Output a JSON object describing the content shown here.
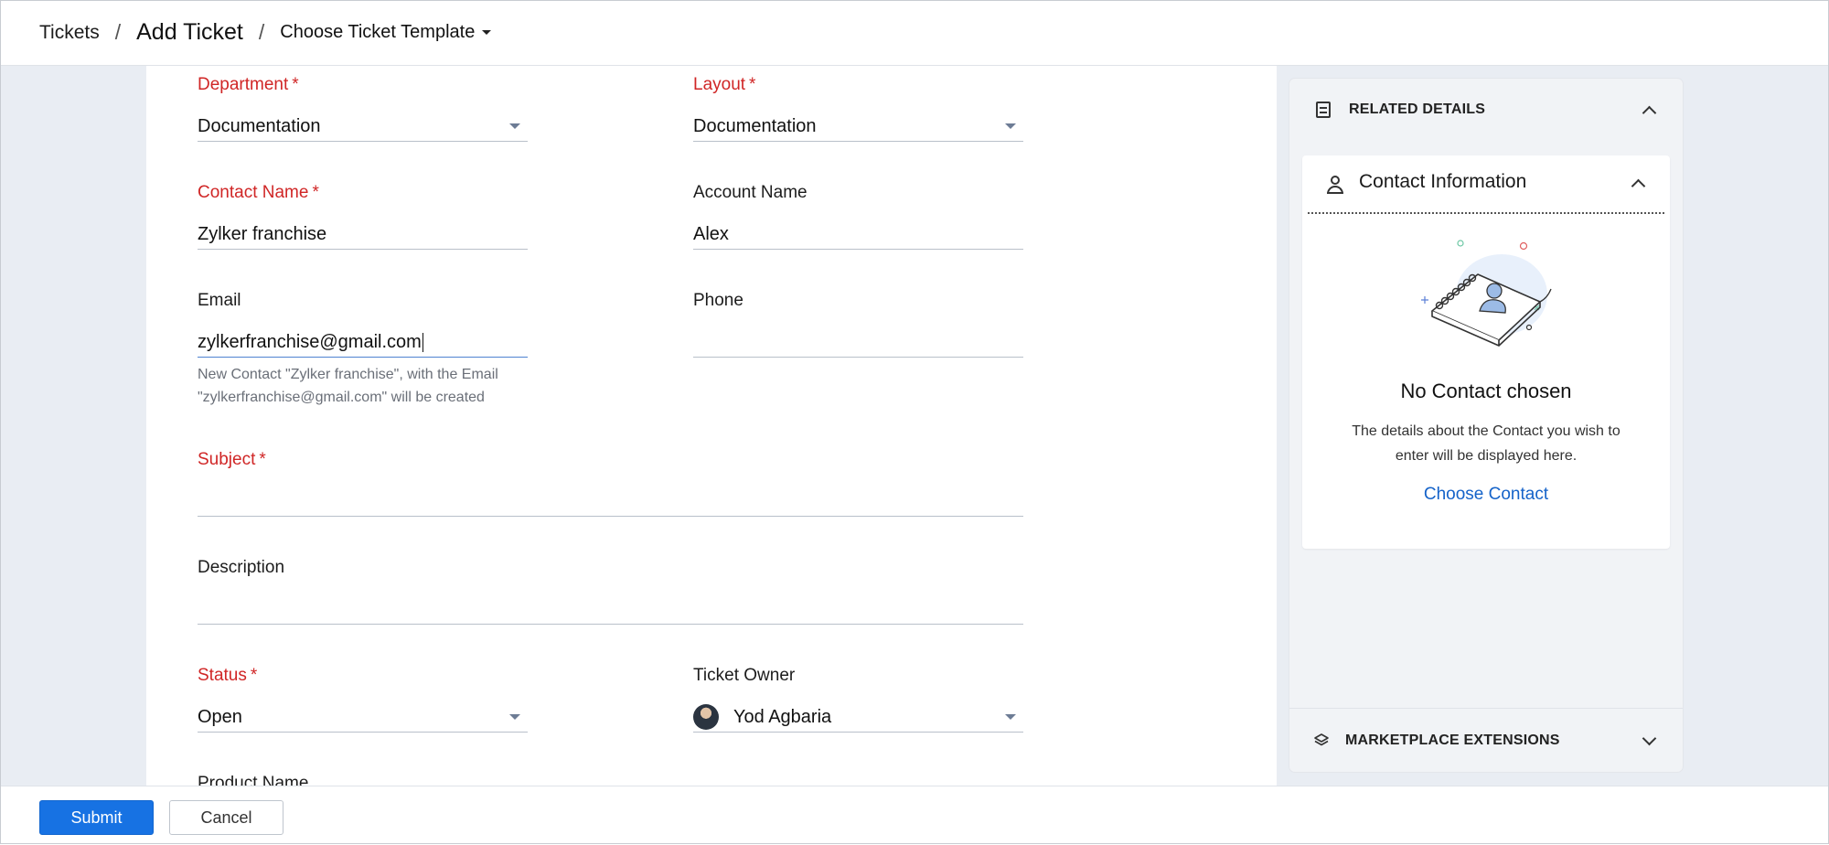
{
  "breadcrumb": {
    "tickets": "Tickets",
    "separator": "/",
    "add_ticket": "Add Ticket",
    "template": "Choose Ticket Template"
  },
  "form": {
    "department": {
      "label": "Department",
      "value": "Documentation"
    },
    "layout": {
      "label": "Layout",
      "value": "Documentation"
    },
    "contact_name": {
      "label": "Contact Name",
      "value": "Zylker franchise"
    },
    "account_name": {
      "label": "Account Name",
      "value": "Alex"
    },
    "email": {
      "label": "Email",
      "value": "zylkerfranchise@gmail.com",
      "hint": "New Contact \"Zylker franchise\", with the Email \"zylkerfranchise@gmail.com\" will be created"
    },
    "phone": {
      "label": "Phone",
      "value": ""
    },
    "subject": {
      "label": "Subject",
      "value": ""
    },
    "description": {
      "label": "Description",
      "value": ""
    },
    "status": {
      "label": "Status",
      "value": "Open"
    },
    "ticket_owner": {
      "label": "Ticket Owner",
      "value": "Yod Agbaria"
    },
    "product_name": {
      "label": "Product Name"
    },
    "required_marker": "*"
  },
  "footer": {
    "submit": "Submit",
    "cancel": "Cancel"
  },
  "right_panel": {
    "related_details": "RELATED DETAILS",
    "contact_information": "Contact Information",
    "no_contact_title": "No Contact chosen",
    "no_contact_desc": "The details about the Contact you wish to enter will be displayed here.",
    "choose_contact": "Choose Contact",
    "marketplace_extensions": "MARKETPLACE EXTENSIONS"
  },
  "colors": {
    "required_label": "#d02626",
    "primary_button": "#1772e3",
    "link": "#1563c9",
    "page_bg": "#e9edf3"
  }
}
